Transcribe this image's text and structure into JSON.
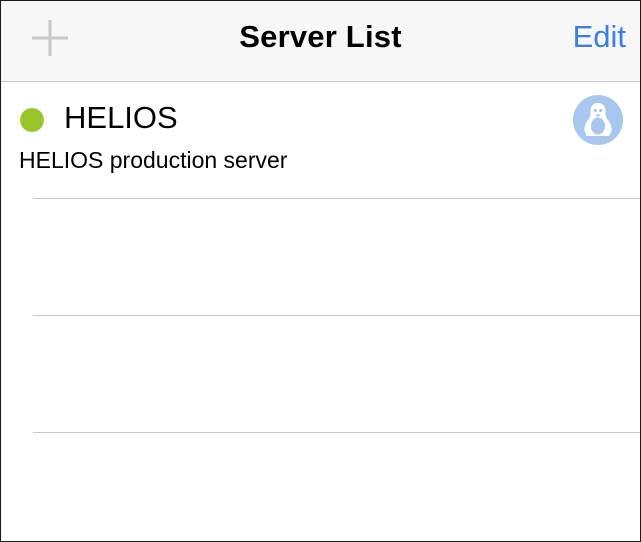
{
  "navbar": {
    "title": "Server List",
    "add_icon": "plus-icon",
    "edit_label": "Edit",
    "colors": {
      "background": "#f7f7f7",
      "accent": "#3b7ee8",
      "add_icon_disabled": "#c7c7cc"
    }
  },
  "servers": [
    {
      "name": "HELIOS",
      "description": "HELIOS production server",
      "status_color": "#9ac52a",
      "os_icon": "linux-tux-icon",
      "os_icon_color": "#a7c7ef"
    }
  ],
  "empty_rows": 3
}
